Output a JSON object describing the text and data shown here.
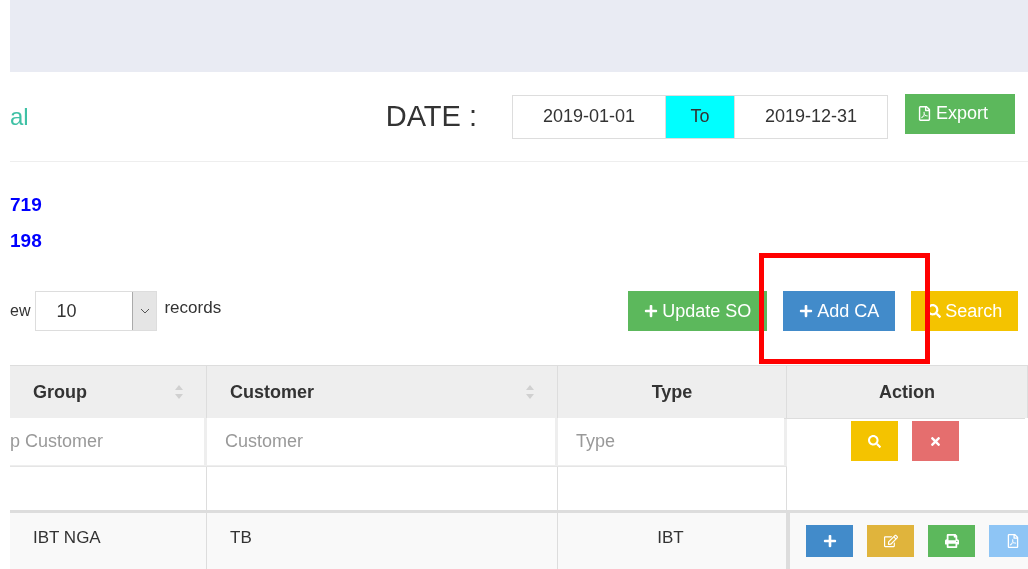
{
  "header": {
    "title": "al",
    "date_label": "DATE :",
    "date_from": "2019-01-01",
    "to_label": "To",
    "date_to": "2019-12-31",
    "export": "Export"
  },
  "totals": [
    "719",
    "198"
  ],
  "length": {
    "prefix": "ew",
    "value": "10",
    "suffix": "records"
  },
  "buttons": [
    {
      "kind": "update",
      "label": "Update SO",
      "highlighted": false
    },
    {
      "kind": "add",
      "label": "Add CA",
      "highlighted": true
    },
    {
      "kind": "search",
      "label": "Search",
      "highlighted": false
    }
  ],
  "table": {
    "columns": [
      {
        "label": "Group",
        "sortable": true
      },
      {
        "label": "Customer",
        "sortable": true
      },
      {
        "label": "Type",
        "sortable": false
      },
      {
        "label": "Action",
        "sortable": false
      }
    ],
    "filters": [
      {
        "placeholder": "p Customer"
      },
      {
        "placeholder": "Customer"
      },
      {
        "placeholder": "Type"
      }
    ],
    "filter_actions": [
      {
        "kind": "search"
      },
      {
        "kind": "clear"
      }
    ],
    "rows": [
      {
        "cells": [
          "IBT NGA",
          "TB",
          "IBT"
        ],
        "actions": [
          {
            "kind": "add"
          },
          {
            "kind": "edit"
          },
          {
            "kind": "print"
          },
          {
            "kind": "pdf"
          }
        ]
      }
    ]
  }
}
